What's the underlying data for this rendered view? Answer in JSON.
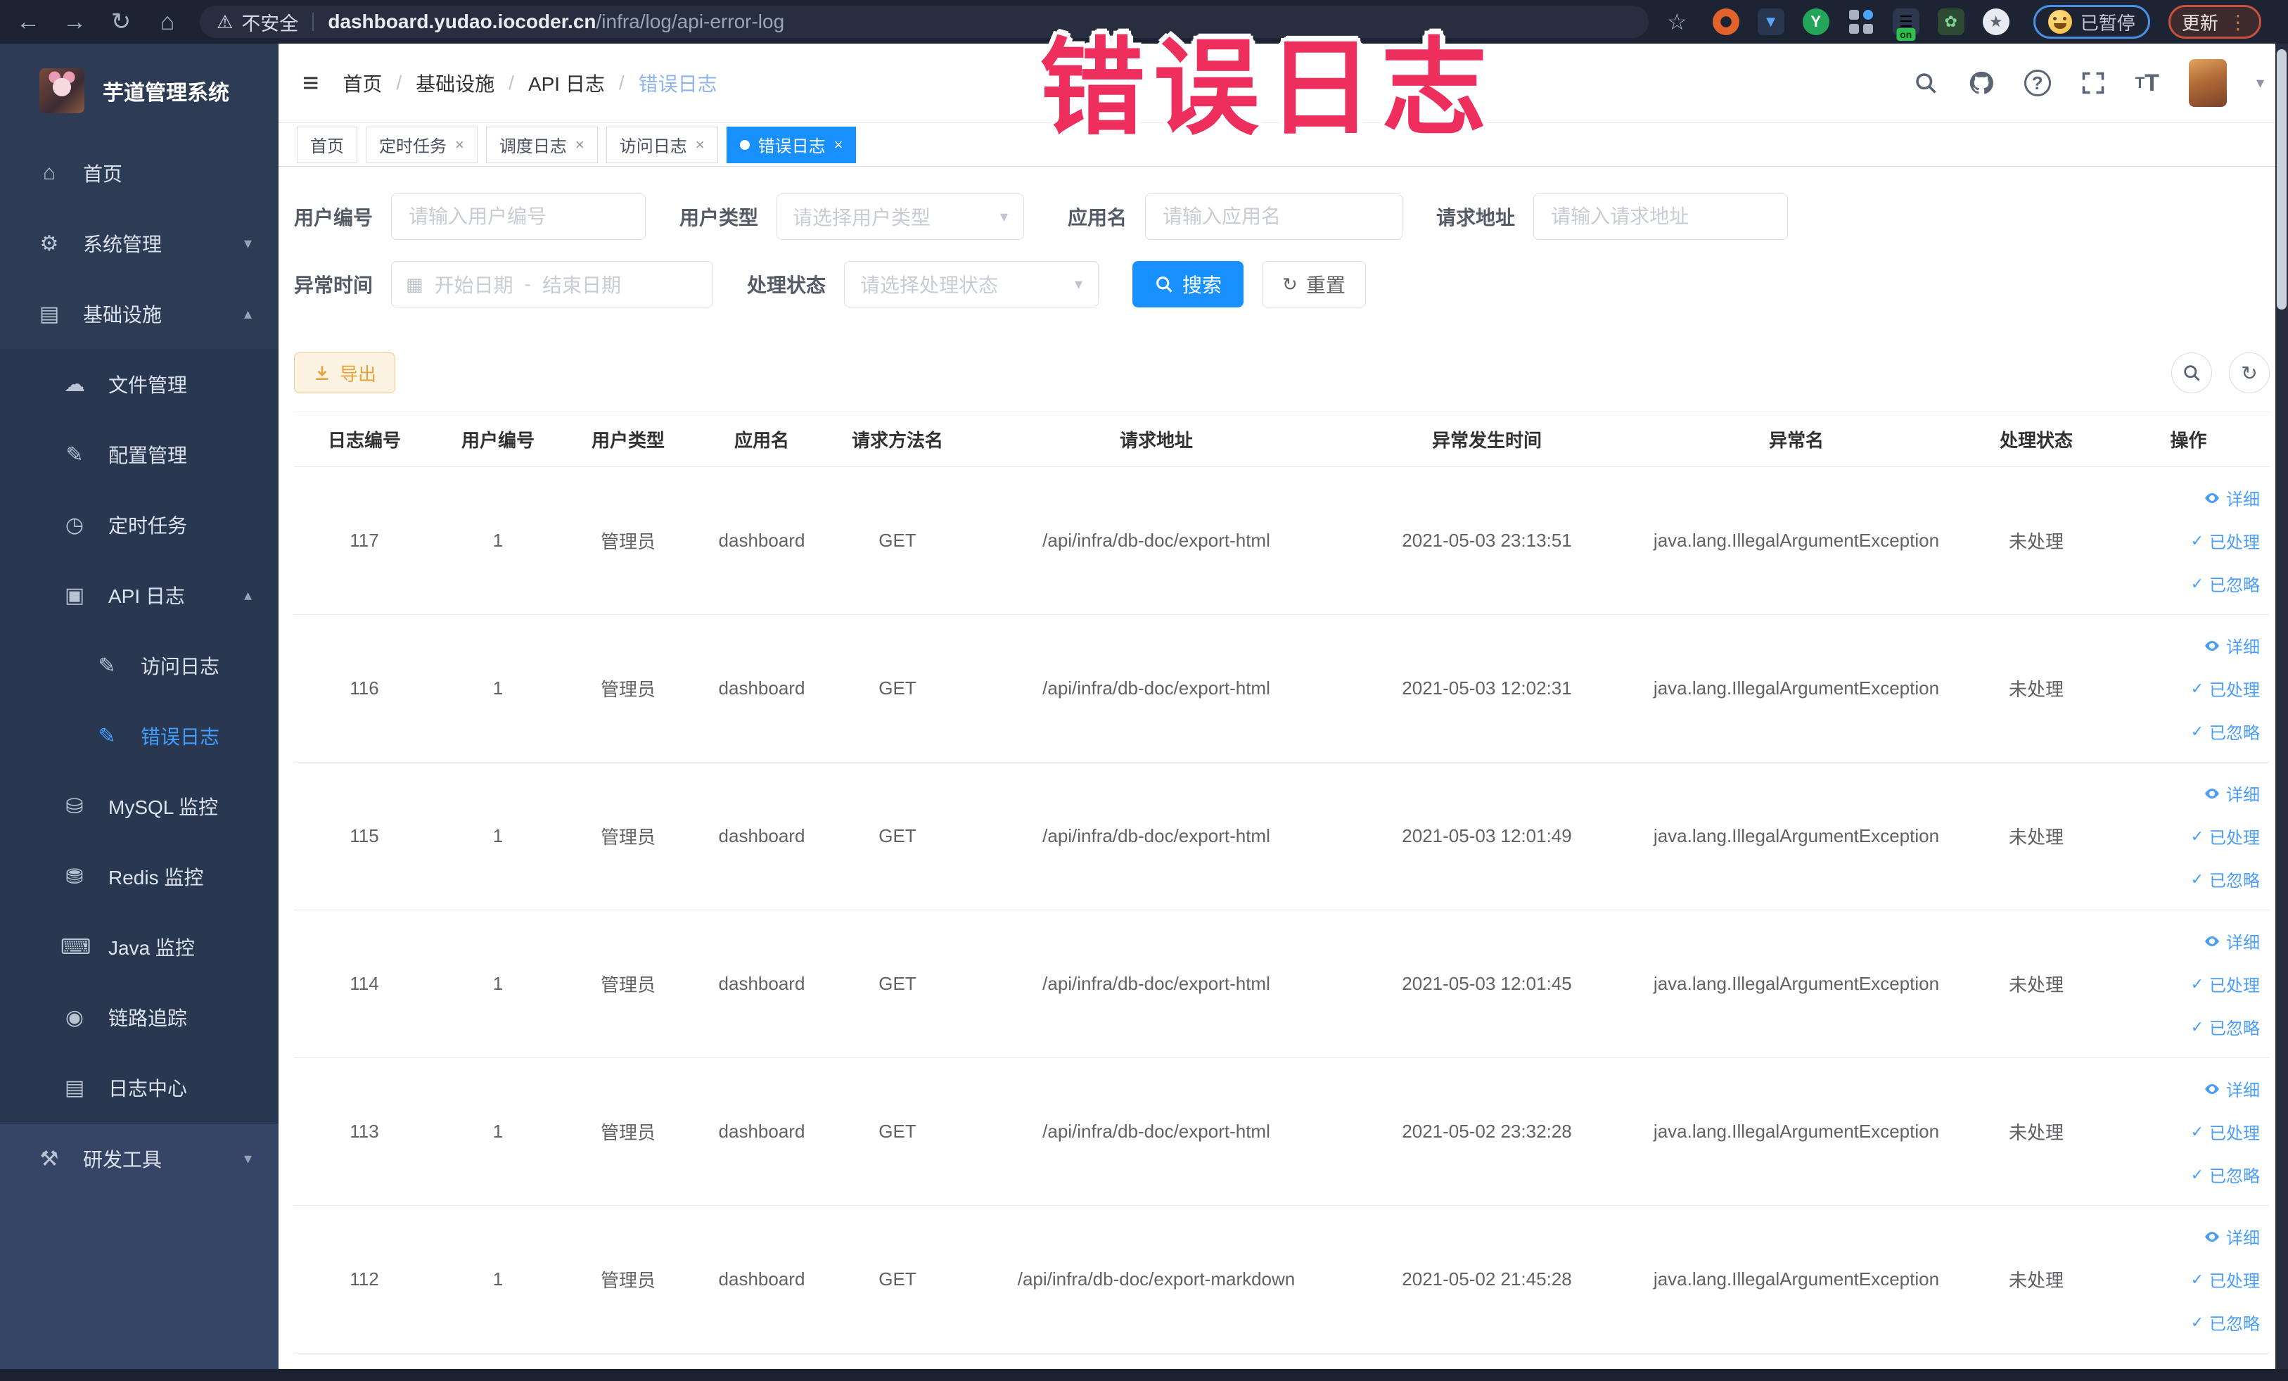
{
  "annotation": {
    "text": "错误日志",
    "color": "#ee2e5c"
  },
  "browser": {
    "security_label": "不安全",
    "url_domain": "dashboard.yudao.iocoder.cn",
    "url_path": "/infra/log/api-error-log",
    "extension_badge": "on",
    "paused_badge": "已暂停",
    "update_button": "更新"
  },
  "sidebar": {
    "title": "芋道管理系统",
    "items": [
      {
        "key": "home",
        "label": "首页",
        "icon": "home-icon",
        "level": 0,
        "group": "top"
      },
      {
        "key": "system",
        "label": "系统管理",
        "icon": "gear-icon",
        "level": 0,
        "group": "top",
        "expand": "down"
      },
      {
        "key": "infra",
        "label": "基础设施",
        "icon": "infra-icon",
        "level": 0,
        "group": "top",
        "expand": "up"
      },
      {
        "key": "file",
        "label": "文件管理",
        "icon": "cloud-icon",
        "level": 1,
        "group": "infra"
      },
      {
        "key": "config",
        "label": "配置管理",
        "icon": "edit-icon",
        "level": 1,
        "group": "infra"
      },
      {
        "key": "job",
        "label": "定时任务",
        "icon": "timer-icon",
        "level": 1,
        "group": "infra"
      },
      {
        "key": "api-log",
        "label": "API 日志",
        "icon": "api-log-icon",
        "level": 1,
        "group": "infra",
        "expand": "up"
      },
      {
        "key": "access-log",
        "label": "访问日志",
        "icon": "access-log-icon",
        "level": 2,
        "group": "infra"
      },
      {
        "key": "error-log",
        "label": "错误日志",
        "icon": "error-log-icon",
        "level": 2,
        "group": "infra",
        "active": true
      },
      {
        "key": "mysql",
        "label": "MySQL 监控",
        "icon": "mysql-icon",
        "level": 1,
        "group": "infra"
      },
      {
        "key": "redis",
        "label": "Redis 监控",
        "icon": "redis-icon",
        "level": 1,
        "group": "infra"
      },
      {
        "key": "java",
        "label": "Java 监控",
        "icon": "java-icon",
        "level": 1,
        "group": "infra"
      },
      {
        "key": "tracer",
        "label": "链路追踪",
        "icon": "trace-icon",
        "level": 1,
        "group": "infra"
      },
      {
        "key": "log-center",
        "label": "日志中心",
        "icon": "log-center-icon",
        "level": 1,
        "group": "infra"
      },
      {
        "key": "dev-tools",
        "label": "研发工具",
        "icon": "tools-icon",
        "level": 0,
        "group": "bottom",
        "expand": "down"
      }
    ]
  },
  "header": {
    "breadcrumb": [
      "首页",
      "基础设施",
      "API 日志",
      "错误日志"
    ]
  },
  "tabs": [
    {
      "key": "home",
      "label": "首页",
      "closable": false,
      "active": false
    },
    {
      "key": "job",
      "label": "定时任务",
      "closable": true,
      "active": false
    },
    {
      "key": "job-log",
      "label": "调度日志",
      "closable": true,
      "active": false
    },
    {
      "key": "access-log",
      "label": "访问日志",
      "closable": true,
      "active": false
    },
    {
      "key": "error-log",
      "label": "错误日志",
      "closable": true,
      "active": true
    }
  ],
  "filters": {
    "row1": [
      {
        "label": "用户编号",
        "placeholder": "请输入用户编号",
        "type": "input"
      },
      {
        "label": "用户类型",
        "placeholder": "请选择用户类型",
        "type": "select"
      },
      {
        "label": "应用名",
        "placeholder": "请输入应用名",
        "type": "input"
      },
      {
        "label": "请求地址",
        "placeholder": "请输入请求地址",
        "type": "input"
      }
    ],
    "row2": [
      {
        "label": "异常时间",
        "type": "daterange",
        "start_placeholder": "开始日期",
        "separator": "-",
        "end_placeholder": "结束日期"
      },
      {
        "label": "处理状态",
        "placeholder": "请选择处理状态",
        "type": "select"
      }
    ],
    "search_label": "搜索",
    "reset_label": "重置"
  },
  "toolbar": {
    "export_label": "导出"
  },
  "table": {
    "columns": [
      {
        "key": "log_id",
        "label": "日志编号"
      },
      {
        "key": "user_id",
        "label": "用户编号"
      },
      {
        "key": "user_type",
        "label": "用户类型"
      },
      {
        "key": "app_name",
        "label": "应用名"
      },
      {
        "key": "method",
        "label": "请求方法名"
      },
      {
        "key": "url",
        "label": "请求地址"
      },
      {
        "key": "time",
        "label": "异常发生时间"
      },
      {
        "key": "exception",
        "label": "异常名"
      },
      {
        "key": "status",
        "label": "处理状态"
      },
      {
        "key": "actions",
        "label": "操作"
      }
    ],
    "row_actions": [
      {
        "key": "detail",
        "label": "详细",
        "icon": "eye-icon"
      },
      {
        "key": "processed",
        "label": "已处理",
        "icon": "check-icon"
      },
      {
        "key": "ignored",
        "label": "已忽略",
        "icon": "check-icon"
      }
    ],
    "rows": [
      {
        "log_id": "117",
        "user_id": "1",
        "user_type": "管理员",
        "app_name": "dashboard",
        "method": "GET",
        "url": "/api/infra/db-doc/export-html",
        "time": "2021-05-03 23:13:51",
        "exception": "java.lang.IllegalArgumentException",
        "status": "未处理"
      },
      {
        "log_id": "116",
        "user_id": "1",
        "user_type": "管理员",
        "app_name": "dashboard",
        "method": "GET",
        "url": "/api/infra/db-doc/export-html",
        "time": "2021-05-03 12:02:31",
        "exception": "java.lang.IllegalArgumentException",
        "status": "未处理"
      },
      {
        "log_id": "115",
        "user_id": "1",
        "user_type": "管理员",
        "app_name": "dashboard",
        "method": "GET",
        "url": "/api/infra/db-doc/export-html",
        "time": "2021-05-03 12:01:49",
        "exception": "java.lang.IllegalArgumentException",
        "status": "未处理"
      },
      {
        "log_id": "114",
        "user_id": "1",
        "user_type": "管理员",
        "app_name": "dashboard",
        "method": "GET",
        "url": "/api/infra/db-doc/export-html",
        "time": "2021-05-03 12:01:45",
        "exception": "java.lang.IllegalArgumentException",
        "status": "未处理"
      },
      {
        "log_id": "113",
        "user_id": "1",
        "user_type": "管理员",
        "app_name": "dashboard",
        "method": "GET",
        "url": "/api/infra/db-doc/export-html",
        "time": "2021-05-02 23:32:28",
        "exception": "java.lang.IllegalArgumentException",
        "status": "未处理"
      },
      {
        "log_id": "112",
        "user_id": "1",
        "user_type": "管理员",
        "app_name": "dashboard",
        "method": "GET",
        "url": "/api/infra/db-doc/export-markdown",
        "time": "2021-05-02 21:45:28",
        "exception": "java.lang.IllegalArgumentException",
        "status": "未处理"
      }
    ]
  }
}
